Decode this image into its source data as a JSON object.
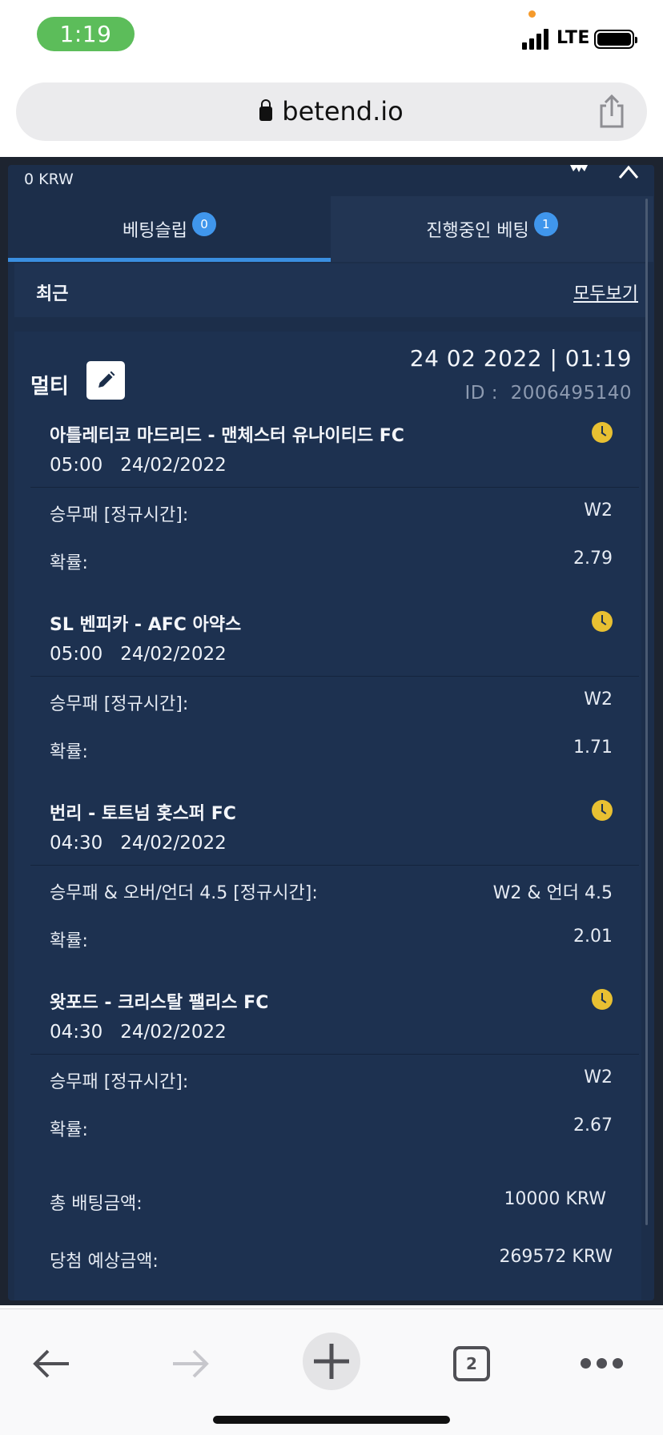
{
  "status_bar": {
    "time": "1:19",
    "network": "LTE"
  },
  "browser": {
    "url": "betend.io"
  },
  "panel": {
    "balance": "0 KRW",
    "tabs": [
      {
        "label": "베팅슬립",
        "badge": "0"
      },
      {
        "label": "진행중인 베팅",
        "badge": "1"
      }
    ],
    "recent_label": "최근",
    "view_all": "모두보기"
  },
  "bet": {
    "type_label": "멀티",
    "datetime": "24 02 2022 | 01:19",
    "id_label": "ID :",
    "id_value": "2006495140",
    "events": [
      {
        "title": "아틀레티코 마드리드 - 맨체스터 유나이티드 FC",
        "time": "05:00",
        "date": "24/02/2022",
        "market_label": "승무패 [정규시간]:",
        "market_value": "W2",
        "odds_label": "확률:",
        "odds_value": "2.79"
      },
      {
        "title": "SL 벤피카 - AFC 아약스",
        "time": "05:00",
        "date": "24/02/2022",
        "market_label": "승무패 [정규시간]:",
        "market_value": "W2",
        "odds_label": "확률:",
        "odds_value": "1.71"
      },
      {
        "title": "번리 - 토트넘 홋스퍼 FC",
        "time": "04:30",
        "date": "24/02/2022",
        "market_label": "승무패 & 오버/언더 4.5 [정규시간]:",
        "market_value": "W2 & 언더 4.5",
        "odds_label": "확률:",
        "odds_value": "2.01"
      },
      {
        "title": "왓포드 - 크리스탈 팰리스 FC",
        "time": "04:30",
        "date": "24/02/2022",
        "market_label": "승무패 [정규시간]:",
        "market_value": "W2",
        "odds_label": "확률:",
        "odds_value": "2.67"
      }
    ],
    "total_stake_label": "총 배팅금액:",
    "total_stake_value": "10000 KRW",
    "potential_win_label": "당첨 예상금액:",
    "potential_win_value": "269572 KRW"
  },
  "toolbar": {
    "tabs_count": "2"
  },
  "colors": {
    "panel_bg": "#1c2e4a",
    "accent": "#3a8fe0",
    "badge": "#4096ec",
    "clock": "#e8c032",
    "time_pill": "#5cbd5a"
  }
}
